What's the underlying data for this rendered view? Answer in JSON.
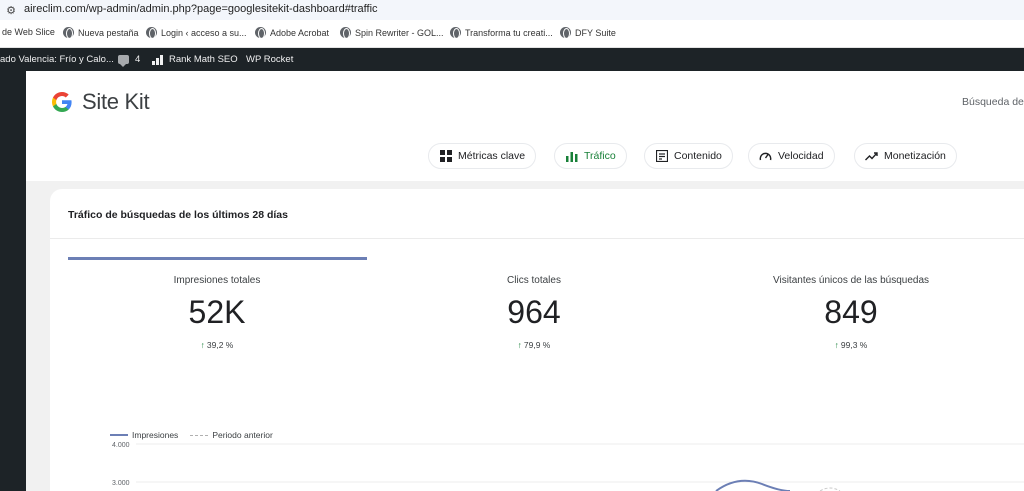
{
  "browser": {
    "url": "aireclim.com/wp-admin/admin.php?page=googlesitekit-dashboard#traffic",
    "bookmarks": [
      "de Web Slice",
      "Nueva pestaña",
      "Login ‹ acceso a su...",
      "Adobe Acrobat",
      "Spin Rewriter - GOL...",
      "Transforma tu creati...",
      "DFY Suite"
    ]
  },
  "admin_bar": {
    "site_name": "ado Valencia: Frío y Calo...",
    "comments_count": "4",
    "rank_math": "Rank Math SEO",
    "wp_rocket": "WP Rocket"
  },
  "header": {
    "app_name": "Site Kit",
    "search_link": "Búsqueda de"
  },
  "nav": {
    "tabs": [
      {
        "label": "Métricas clave",
        "icon": "grid-icon"
      },
      {
        "label": "Tráfico",
        "icon": "bar-chart-icon",
        "active": true
      },
      {
        "label": "Contenido",
        "icon": "document-icon"
      },
      {
        "label": "Velocidad",
        "icon": "speedometer-icon"
      },
      {
        "label": "Monetización",
        "icon": "trend-icon"
      }
    ]
  },
  "card": {
    "title": "Tráfico de búsquedas de los últimos 28 días",
    "metrics": [
      {
        "label": "Impresiones totales",
        "value": "52K",
        "delta": "39,2 %"
      },
      {
        "label": "Clics totales",
        "value": "964",
        "delta": "79,9 %"
      },
      {
        "label": "Visitantes únicos de las búsquedas",
        "value": "849",
        "delta": "99,3 %"
      }
    ],
    "legend": {
      "current": "Impresiones",
      "previous": "Periodo anterior"
    }
  },
  "chart_data": {
    "type": "line",
    "ytick_labels": [
      "4.000",
      "3.000"
    ],
    "series": [
      {
        "name": "Impresiones",
        "color": "#6c7fb5"
      },
      {
        "name": "Periodo anterior",
        "color": "#b0b0b0"
      }
    ]
  },
  "colors": {
    "accent_green": "#188038",
    "admin_bar": "#1d2327",
    "series_blue": "#6c7fb5"
  }
}
